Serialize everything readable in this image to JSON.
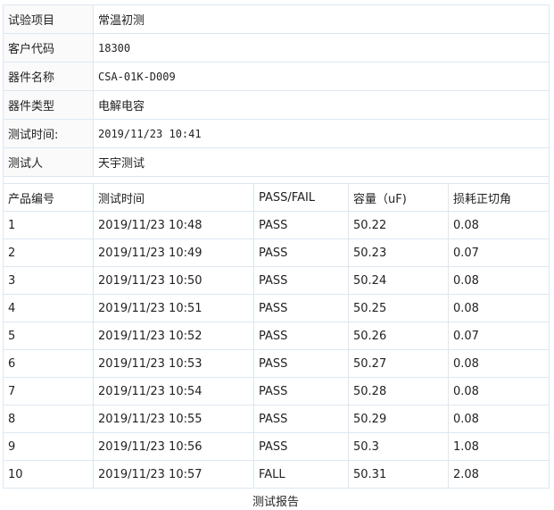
{
  "info": [
    {
      "label": "试验项目",
      "value": "常温初测",
      "mono": false
    },
    {
      "label": "客户代码",
      "value": "18300",
      "mono": true
    },
    {
      "label": "器件名称",
      "value": "CSA-01K-D009",
      "mono": true
    },
    {
      "label": "器件类型",
      "value": "电解电容",
      "mono": false
    },
    {
      "label": "测试时间:",
      "value": "2019/11/23 10:41",
      "mono": true
    },
    {
      "label": "测试人",
      "value": "天宇测试",
      "mono": false
    }
  ],
  "headers": [
    "产品编号",
    "测试时间",
    "PASS/FAIL",
    "容量（uF)",
    "损耗正切角"
  ],
  "rows": [
    [
      "1",
      "2019/11/23 10:48",
      "PASS",
      "50.22",
      "0.08"
    ],
    [
      "2",
      "2019/11/23 10:49",
      "PASS",
      "50.23",
      "0.07"
    ],
    [
      "3",
      "2019/11/23 10:50",
      "PASS",
      "50.24",
      "0.08"
    ],
    [
      "4",
      "2019/11/23 10:51",
      "PASS",
      "50.25",
      "0.08"
    ],
    [
      "5",
      "2019/11/23 10:52",
      "PASS",
      "50.26",
      "0.07"
    ],
    [
      "6",
      "2019/11/23 10:53",
      "PASS",
      "50.27",
      "0.08"
    ],
    [
      "7",
      "2019/11/23 10:54",
      "PASS",
      "50.28",
      "0.08"
    ],
    [
      "8",
      "2019/11/23 10:55",
      "PASS",
      "50.29",
      "0.08"
    ],
    [
      "9",
      "2019/11/23 10:56",
      "PASS",
      "50.3",
      "1.08"
    ],
    [
      "10",
      "2019/11/23 10:57",
      "FALL",
      "50.31",
      "2.08"
    ]
  ],
  "caption": "测试报告"
}
